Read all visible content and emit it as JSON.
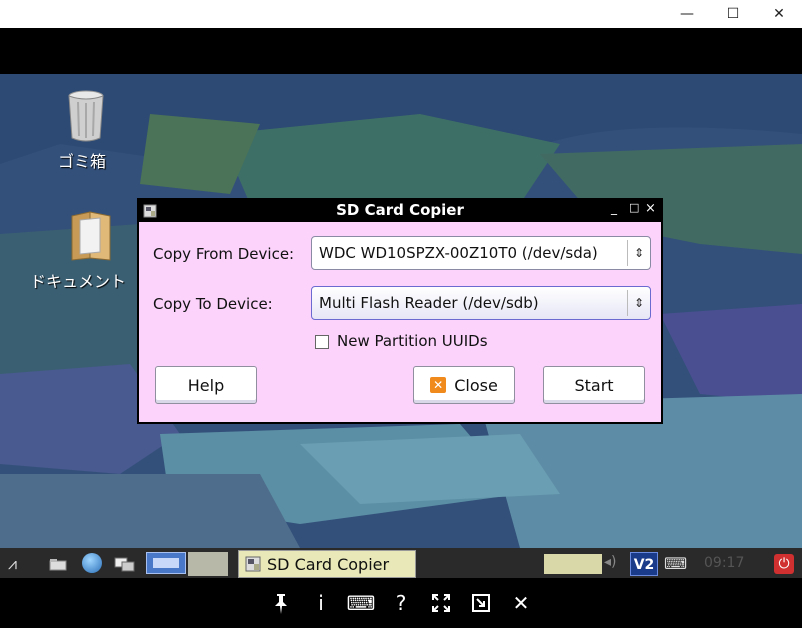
{
  "window": {
    "minimize_icon": "minimize-icon",
    "maximize_icon": "maximize-icon",
    "close_icon": "close-icon"
  },
  "desktop": {
    "icons": [
      {
        "label": "ゴミ箱",
        "icon": "trash-icon"
      },
      {
        "label": "ドキュメント",
        "icon": "documents-folder-icon"
      }
    ]
  },
  "dialog": {
    "title": "SD Card Copier",
    "title_controls": [
      "_",
      "□",
      "×"
    ],
    "copy_from_label": "Copy From Device:",
    "copy_from_value": "WDC WD10SPZX-00Z10T0  (/dev/sda)",
    "copy_to_label": "Copy To Device:",
    "copy_to_value": "Multi Flash Reader  (/dev/sdb)",
    "new_uuids_label": "New Partition UUIDs",
    "new_uuids_checked": false,
    "help_label": "Help",
    "close_label": "Close",
    "start_label": "Start"
  },
  "taskbar": {
    "task_label": "SD Card Copier",
    "clock": "09:17"
  },
  "remote_toolbar": {
    "icons": [
      "pin-icon",
      "info-icon",
      "keyboard-icon",
      "help-icon",
      "fullscreen-icon",
      "scale-icon",
      "disconnect-icon"
    ],
    "glyphs": [
      "📌",
      "i",
      "⌨",
      "?",
      "⛶",
      "⧉",
      "✕"
    ]
  },
  "colors": {
    "dialog_bg": "#fbd3fb",
    "desktop_bg": "#33507a",
    "taskbar_highlight": "#e8e8b8"
  }
}
